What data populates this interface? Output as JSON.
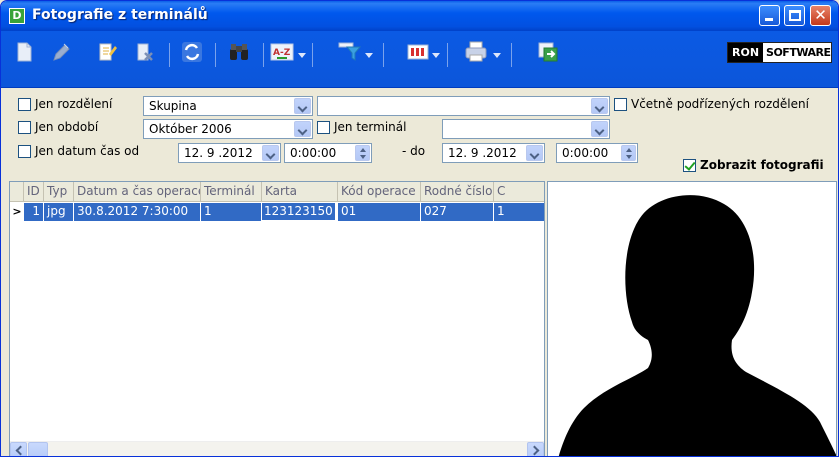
{
  "window": {
    "title": "Fotografie z terminálů",
    "app_icon_letter": "D"
  },
  "toolbar": {
    "icons": [
      "new-icon",
      "edit-icon",
      "note-icon",
      "delete-icon",
      "refresh-icon",
      "search-icon",
      "sort-az-icon",
      "filter-icon",
      "columns-icon",
      "print-icon",
      "export-icon"
    ],
    "sort_label": "A-Z",
    "logo": {
      "left": "RON",
      "right": "SOFTWARE"
    }
  },
  "filters": {
    "rozdeleni": {
      "label": "Jen rozdělení",
      "checked": false,
      "value": "Skupina",
      "value2": ""
    },
    "podrizene": {
      "label": "Včetně podřízených rozdělení",
      "checked": false
    },
    "obdobi": {
      "label": "Jen období",
      "checked": false,
      "value": "Október 2006"
    },
    "terminal": {
      "label": "Jen terminál",
      "checked": false,
      "value": ""
    },
    "datum": {
      "label": "Jen datum čas od",
      "checked": false,
      "from_date": "12. 9 .2012",
      "from_time": "0:00:00",
      "to_label": "- do",
      "to_date": "12. 9 .2012",
      "to_time": "0:00:00"
    },
    "show_photo": {
      "label": "Zobrazit fotografii",
      "checked": true
    }
  },
  "grid": {
    "columns": [
      "ID",
      "Typ",
      "Datum a čas operace",
      "Terminál",
      "Karta",
      "Kód operace",
      "Rodné číslo",
      "C"
    ],
    "rows": [
      [
        "1",
        "jpg",
        "30.8.2012 7:30:00",
        "1",
        "123123150",
        "01",
        "027",
        "1"
      ]
    ],
    "row_indicator": ">"
  },
  "colors": {
    "titlebar": "#0058ee",
    "selection": "#316ac5",
    "face": "#ece9d8"
  }
}
